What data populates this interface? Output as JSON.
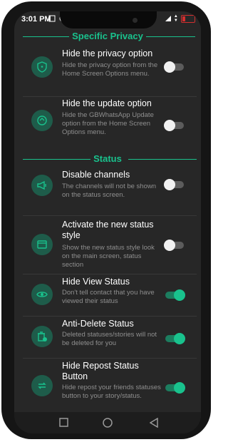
{
  "status_bar": {
    "time": "3:01 PM"
  },
  "sections": {
    "privacy": {
      "title": "Specific Privacy"
    },
    "status": {
      "title": "Status"
    }
  },
  "settings": [
    {
      "title": "Hide the privacy option",
      "description": "Hide the privacy option from the Home Screen Options menu.",
      "enabled": false,
      "icon": "shield-icon"
    },
    {
      "title": "Hide the update option",
      "description": "Hide the GBWhatsApp Update option from the Home Screen Options menu.",
      "enabled": false,
      "icon": "update-icon"
    },
    {
      "title": "Disable channels",
      "description": "The channels will not be shown on the status screen.",
      "enabled": false,
      "icon": "megaphone-icon"
    },
    {
      "title": "Activate the new status style",
      "description": "Show the new status style look on the main screen, status section",
      "enabled": false,
      "icon": "window-icon"
    },
    {
      "title": "Hide View Status",
      "description": "Don't tell contact that you have viewed their status",
      "enabled": true,
      "icon": "eye-icon"
    },
    {
      "title": "Anti-Delete Status",
      "description": "Deleted statuses/stories will not be deleted for you",
      "enabled": true,
      "icon": "trash-icon"
    },
    {
      "title": "Hide Repost Status Button",
      "description": "Hide repost your friends statuses button to your story/status.",
      "enabled": true,
      "icon": "repost-icon"
    }
  ],
  "colors": {
    "accent": "#19c28d",
    "background": "#272727",
    "icon_bg": "#1e5c4a"
  }
}
